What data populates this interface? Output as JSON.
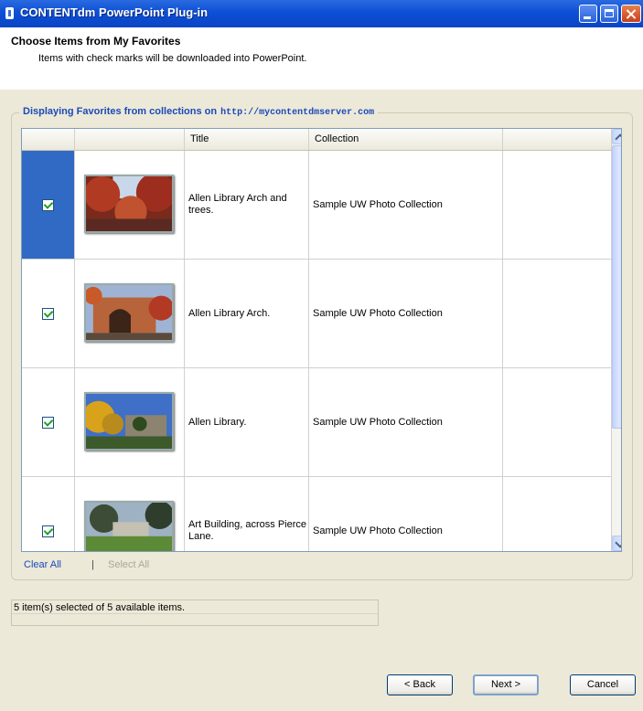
{
  "window": {
    "title": "CONTENTdm PowerPoint Plug-in"
  },
  "header": {
    "title": "Choose Items from My Favorites",
    "subtitle": "Items with check marks will be downloaded into PowerPoint."
  },
  "group": {
    "title": "Displaying Favorites from collections on",
    "url": "http://mycontentdmserver.com"
  },
  "table": {
    "columns": [
      "",
      "",
      "Title",
      "Collection",
      ""
    ],
    "rows": [
      {
        "checked": true,
        "selected": true,
        "title": "Allen Library Arch and trees.",
        "collection": "Sample UW Photo Collection",
        "thumb": "autumn-arch-photo"
      },
      {
        "checked": true,
        "selected": false,
        "title": "Allen Library Arch.",
        "collection": "Sample UW Photo Collection",
        "thumb": "brick-arch-photo"
      },
      {
        "checked": true,
        "selected": false,
        "title": "Allen Library.",
        "collection": "Sample UW Photo Collection",
        "thumb": "library-trees-photo"
      },
      {
        "checked": true,
        "selected": false,
        "title": "Art Building, across Pierce Lane.",
        "collection": "Sample UW Photo Collection",
        "thumb": "art-building-photo"
      }
    ]
  },
  "links": {
    "clear_all": "Clear All",
    "separator": "|",
    "select_all": "Select All"
  },
  "status": {
    "text": "5 item(s) selected of 5 available items."
  },
  "buttons": {
    "back": "< Back",
    "next": "Next >",
    "cancel": "Cancel"
  }
}
